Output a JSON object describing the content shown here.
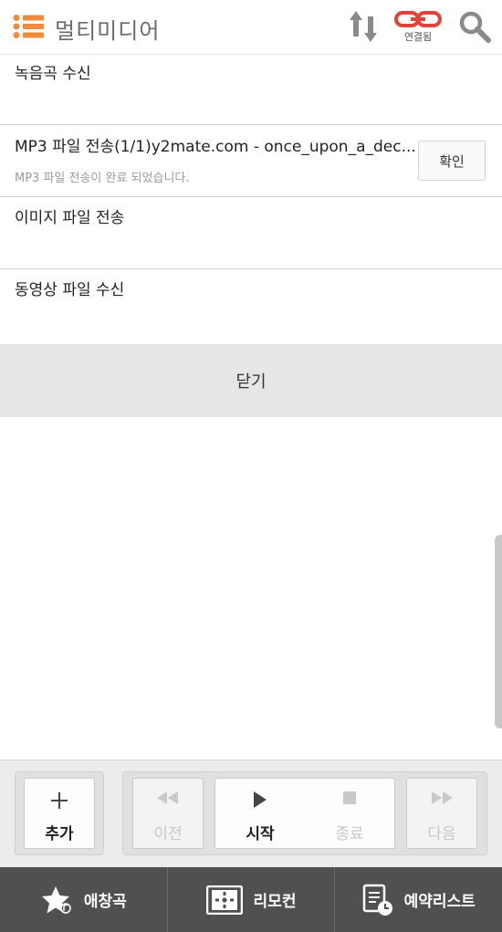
{
  "header": {
    "title": "멀티미디어",
    "link_status": "연결됨",
    "accent_color": "#f08a3c",
    "link_color": "#e0433a"
  },
  "transfers": [
    {
      "title": "녹음곡 수신",
      "subtitle": ""
    },
    {
      "title": "MP3 파일 전송(1/1)y2mate.com - once_upon_a_dec...",
      "subtitle": "MP3 파일 전송이 완료 되었습니다.",
      "button": "확인"
    },
    {
      "title": "이미지 파일 전송",
      "subtitle": ""
    },
    {
      "title": "동영상 파일 수신",
      "subtitle": ""
    }
  ],
  "close_label": "닫기",
  "controls": {
    "add": "추가",
    "prev": "이전",
    "start": "시작",
    "stop": "종료",
    "next": "다음"
  },
  "bottom_nav": [
    {
      "label": "애창곡",
      "icon": "star-music-icon"
    },
    {
      "label": "리모컨",
      "icon": "remote-icon"
    },
    {
      "label": "예약리스트",
      "icon": "reserve-list-icon"
    }
  ]
}
